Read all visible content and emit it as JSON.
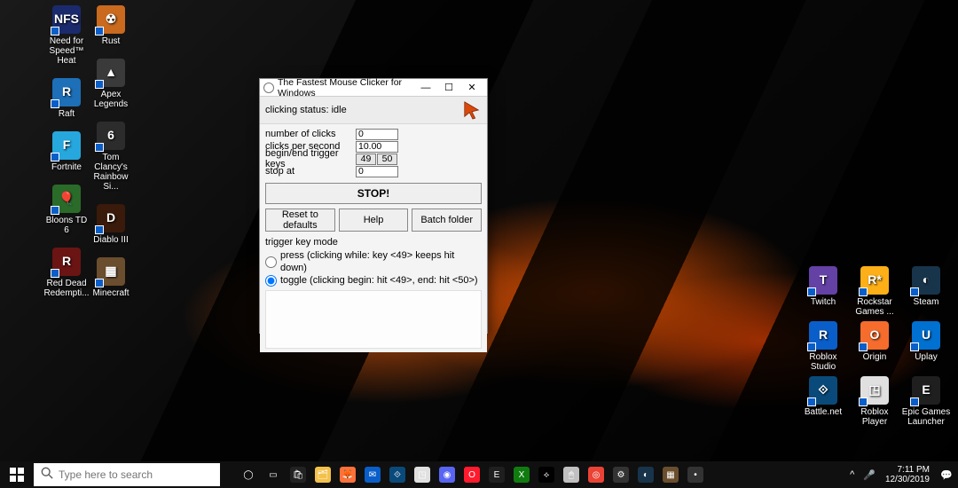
{
  "wallpaper": {
    "theme": "dark-lava-cubes"
  },
  "desktop_icons_left_col1": [
    {
      "label": "Need for Speed™ Heat",
      "bg": "#1a2a6c",
      "glyph": "NFS"
    },
    {
      "label": "Raft",
      "bg": "#1d6fb8",
      "glyph": "R"
    },
    {
      "label": "Fortnite",
      "bg": "#26a7de",
      "glyph": "F"
    },
    {
      "label": "Bloons TD 6",
      "bg": "#2a6b2a",
      "glyph": "🎈"
    },
    {
      "label": "Red Dead Redempti...",
      "bg": "#6b1414",
      "glyph": "R"
    }
  ],
  "desktop_icons_left_col2": [
    {
      "label": "Rust",
      "bg": "#c96a1f",
      "glyph": "☢"
    },
    {
      "label": "Apex Legends",
      "bg": "#3a3a3a",
      "glyph": "▲"
    },
    {
      "label": "Tom Clancy's Rainbow Si...",
      "bg": "#2c2c2c",
      "glyph": "6"
    },
    {
      "label": "Diablo III",
      "bg": "#3a1a0a",
      "glyph": "D"
    },
    {
      "label": "Minecraft",
      "bg": "#6b4e2e",
      "glyph": "▦"
    }
  ],
  "desktop_icons_right": [
    {
      "label": "Twitch",
      "bg": "#6441a5",
      "glyph": "T"
    },
    {
      "label": "Rockstar Games ...",
      "bg": "#fcaf17",
      "glyph": "R*"
    },
    {
      "label": "Steam",
      "bg": "#18344a",
      "glyph": "◐"
    },
    {
      "label": "Roblox Studio",
      "bg": "#0a5ec9",
      "glyph": "R"
    },
    {
      "label": "Origin",
      "bg": "#f56c2d",
      "glyph": "O"
    },
    {
      "label": "Uplay",
      "bg": "#0070d1",
      "glyph": "U"
    },
    {
      "label": "Battle.net",
      "bg": "#0a4a7a",
      "glyph": "⟐"
    },
    {
      "label": "Roblox Player",
      "bg": "#e0e0e0",
      "glyph": "◳"
    },
    {
      "label": "Epic Games Launcher",
      "bg": "#1f1f1f",
      "glyph": "E"
    }
  ],
  "app": {
    "title": "The Fastest Mouse Clicker for Windows",
    "status_label": "clicking status: idle",
    "fields": {
      "num_clicks_label": "number of clicks",
      "num_clicks_value": "0",
      "cps_label": "clicks per second",
      "cps_value": "10.00",
      "trigger_label": "begin/end trigger keys",
      "trigger_begin": "49",
      "trigger_end": "50",
      "stop_at_label": "stop at",
      "stop_at_value": "0"
    },
    "buttons": {
      "stop": "STOP!",
      "reset": "Reset to defaults",
      "help": "Help",
      "batch": "Batch folder"
    },
    "mode": {
      "group_label": "trigger key mode",
      "press_label": "press (clicking while: key <49> keeps hit down)",
      "toggle_label": "toggle (clicking begin: hit <49>, end: hit <50>)",
      "selected": "toggle"
    }
  },
  "taskbar": {
    "search_placeholder": "Type here to search",
    "pinned": [
      {
        "name": "cortana-circle",
        "bg": "transparent",
        "glyph": "◯"
      },
      {
        "name": "task-view",
        "bg": "transparent",
        "glyph": "▭"
      },
      {
        "name": "ms-store",
        "bg": "#222",
        "glyph": "🛍"
      },
      {
        "name": "file-explorer",
        "bg": "#f3c14b",
        "glyph": "🗂"
      },
      {
        "name": "firefox",
        "bg": "#ff7139",
        "glyph": "🦊"
      },
      {
        "name": "mail",
        "bg": "#0a5ec9",
        "glyph": "✉"
      },
      {
        "name": "battle-net",
        "bg": "#0a4a7a",
        "glyph": "⟐"
      },
      {
        "name": "roblox",
        "bg": "#e0e0e0",
        "glyph": "◳"
      },
      {
        "name": "discord",
        "bg": "#5865f2",
        "glyph": "◉"
      },
      {
        "name": "opera",
        "bg": "#ff1b2d",
        "glyph": "O"
      },
      {
        "name": "epic-games",
        "bg": "#1f1f1f",
        "glyph": "E"
      },
      {
        "name": "xbox",
        "bg": "#107c10",
        "glyph": "X"
      },
      {
        "name": "razer",
        "bg": "#000",
        "glyph": "⟡"
      },
      {
        "name": "clicker-app",
        "bg": "#c0c0c0",
        "glyph": "🖱"
      },
      {
        "name": "chrome",
        "bg": "#ea4335",
        "glyph": "◎"
      },
      {
        "name": "settings",
        "bg": "#333",
        "glyph": "⚙"
      },
      {
        "name": "steam",
        "bg": "#18344a",
        "glyph": "◐"
      },
      {
        "name": "minecraft",
        "bg": "#6b4e2e",
        "glyph": "▦"
      },
      {
        "name": "one-more",
        "bg": "#333",
        "glyph": "•"
      }
    ],
    "tray": {
      "chevron": "^",
      "mic": "🎤",
      "time": "7:11 PM",
      "date": "12/30/2019",
      "notif": "💬"
    }
  }
}
